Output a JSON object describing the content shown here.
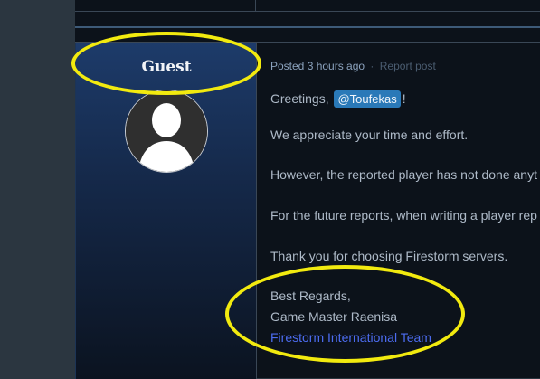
{
  "post": {
    "author": {
      "name": "Guest",
      "avatar_icon": "user-silhouette-icon"
    },
    "meta": {
      "posted": "Posted 3 hours ago",
      "separator": "·",
      "report": "Report post"
    },
    "body": {
      "greeting": "Greetings,",
      "mention": "@Toufekas",
      "greeting_end": "!",
      "p1": "We appreciate your time and effort.",
      "p2": "However, the reported player has not done anyt",
      "p3": "For the future reports, when writing a player rep",
      "p4": "Thank you for choosing Firestorm servers.",
      "signature": {
        "line1": "Best Regards,",
        "line2": "Game Master Raenisa",
        "team": "Firestorm International Team"
      }
    }
  },
  "annotations": {
    "color": "#f2ea0f"
  },
  "colors": {
    "link": "#4c6cf0",
    "mention_bg": "#2a79b8",
    "panel_top": "#1d3b6a"
  }
}
